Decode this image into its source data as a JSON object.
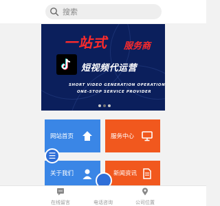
{
  "search": {
    "placeholder": "搜索"
  },
  "banner": {
    "headline": "一站式",
    "headline_suffix": "服务商",
    "subheadline": "短视频代运营",
    "english_line1": "SHORT VIDEO GENERATION OPERATION",
    "english_line2": "ONE-STOP SERVICE PROVIDER",
    "slides": 3,
    "active_slide": 2
  },
  "tiles": [
    {
      "label": "网站首页",
      "icon": "home-icon",
      "color": "#3a86e6"
    },
    {
      "label": "服务中心",
      "icon": "monitor-icon",
      "color": "#f1581e"
    },
    {
      "label": "关于我们",
      "icon": "user-icon",
      "color": "#3a86e6"
    },
    {
      "label": "新闻资讯",
      "icon": "document-icon",
      "color": "#f1581e"
    }
  ],
  "bottom_nav": [
    {
      "label": "在线留言",
      "icon": "message-icon"
    },
    {
      "label": "电话咨询",
      "icon": "phone-icon"
    },
    {
      "label": "公司位置",
      "icon": "location-icon"
    }
  ]
}
